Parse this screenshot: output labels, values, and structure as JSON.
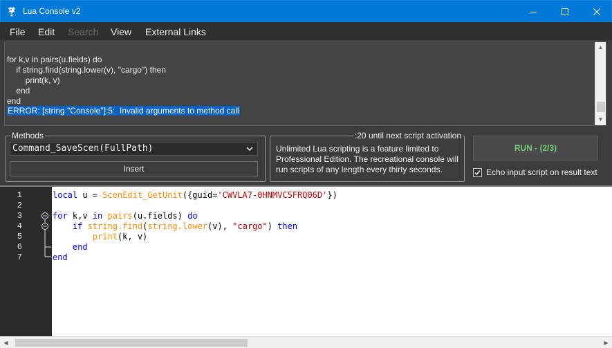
{
  "window": {
    "title": "Lua Console v2",
    "icon": "lua-bird-icon"
  },
  "menu": {
    "items": [
      {
        "label": "File",
        "enabled": true
      },
      {
        "label": "Edit",
        "enabled": true
      },
      {
        "label": "Search",
        "enabled": false
      },
      {
        "label": "View",
        "enabled": true
      },
      {
        "label": "External Links",
        "enabled": true
      }
    ]
  },
  "output": {
    "lines": [
      "for k,v in pairs(u.fields) do",
      "    if string.find(string.lower(v), \"cargo\") then",
      "        print(k, v)",
      "    end",
      "end"
    ],
    "error": "ERROR: [string \"Console\"]:5:  Invalid arguments to method call"
  },
  "methods": {
    "legend": "Methods",
    "selected": "Command_SaveScen(FullPath)",
    "insert_label": "Insert"
  },
  "info": {
    "timer": ":20 until next script activation",
    "message": "Unlimited Lua scripting is a feature limited to Professional Edition. The recreational console will run scripts of any length every thirty seconds."
  },
  "run": {
    "label": "RUN - (2/3)",
    "color": "#74c874"
  },
  "echo": {
    "label": "Echo input script on result text",
    "checked": true
  },
  "editor": {
    "line_numbers": [
      "1",
      "2",
      "3",
      "4",
      "5",
      "6",
      "7"
    ],
    "lines": [
      [
        {
          "t": "local",
          "c": "kw"
        },
        {
          "t": " u = ",
          "c": "ident"
        },
        {
          "t": "ScenEdit_GetUnit",
          "c": "fn"
        },
        {
          "t": "({guid=",
          "c": "ident"
        },
        {
          "t": "'CWVLA7-0HNMVC5FRQ06D'",
          "c": "str"
        },
        {
          "t": "})",
          "c": "ident"
        }
      ],
      [],
      [
        {
          "t": "for",
          "c": "kw"
        },
        {
          "t": " k,v ",
          "c": "ident"
        },
        {
          "t": "in",
          "c": "kw"
        },
        {
          "t": " ",
          "c": "ident"
        },
        {
          "t": "pairs",
          "c": "fn"
        },
        {
          "t": "(u.fields) ",
          "c": "ident"
        },
        {
          "t": "do",
          "c": "kw"
        }
      ],
      [
        {
          "t": "    ",
          "c": "ident"
        },
        {
          "t": "if",
          "c": "kw"
        },
        {
          "t": " ",
          "c": "ident"
        },
        {
          "t": "string.find",
          "c": "fn"
        },
        {
          "t": "(",
          "c": "ident"
        },
        {
          "t": "string.lower",
          "c": "fn"
        },
        {
          "t": "(v), ",
          "c": "ident"
        },
        {
          "t": "\"cargo\"",
          "c": "str"
        },
        {
          "t": ") ",
          "c": "ident"
        },
        {
          "t": "then",
          "c": "kw"
        }
      ],
      [
        {
          "t": "        ",
          "c": "ident"
        },
        {
          "t": "print",
          "c": "fn"
        },
        {
          "t": "(k, v)",
          "c": "ident"
        }
      ],
      [
        {
          "t": "    ",
          "c": "ident"
        },
        {
          "t": "end",
          "c": "kw"
        }
      ],
      [
        {
          "t": "end",
          "c": "kw"
        }
      ]
    ]
  }
}
